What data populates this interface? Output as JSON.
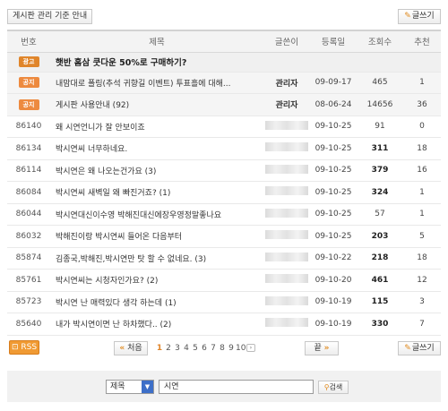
{
  "toolbar": {
    "guide_label": "게시판 관리 기준 안내",
    "write_label": "글쓰기"
  },
  "table": {
    "headers": [
      "번호",
      "제목",
      "글쓴이",
      "등록일",
      "조회수",
      "추천"
    ],
    "ad": {
      "tag": "광고",
      "title": "햇반 홈삼 쿳다운 50%로 구매하기?"
    },
    "notices": [
      {
        "tag": "공지",
        "title": "내맘대로 폴링(추석 귀향길 이벤트) 투표흘에 대해...",
        "writer": "관리자",
        "date": "09-09-17",
        "views": "465",
        "rec": "1"
      },
      {
        "tag": "공지",
        "title": "게시판 사용안내 (92)",
        "writer": "관리자",
        "date": "08-06-24",
        "views": "14656",
        "rec": "36"
      }
    ],
    "rows": [
      {
        "num": "86140",
        "title": "왜 시연언니가 잘 안보이죠",
        "date": "09-10-25",
        "views": "91",
        "hot": false,
        "rec": "0"
      },
      {
        "num": "86134",
        "title": "박시연씨 너무하네요.",
        "date": "09-10-25",
        "views": "311",
        "hot": true,
        "rec": "18"
      },
      {
        "num": "86114",
        "title": "박시연은 왜 나오는건가요 (3)",
        "date": "09-10-25",
        "views": "379",
        "hot": true,
        "rec": "16"
      },
      {
        "num": "86084",
        "title": "박시연씨 새벽일 왜 빠진거죠? (1)",
        "date": "09-10-25",
        "views": "324",
        "hot": true,
        "rec": "1"
      },
      {
        "num": "86044",
        "title": "박시연대신이수영 박해진대신에장우영정말좋나요",
        "date": "09-10-25",
        "views": "57",
        "hot": false,
        "rec": "1"
      },
      {
        "num": "86032",
        "title": "박해진이랑 박시연씨 들어온 다음부터",
        "date": "09-10-25",
        "views": "203",
        "hot": true,
        "rec": "5"
      },
      {
        "num": "85874",
        "title": "김종국,박해진,박시연만 탓 할 수 없네요. (3)",
        "date": "09-10-22",
        "views": "218",
        "hot": true,
        "rec": "18"
      },
      {
        "num": "85761",
        "title": "박시연씨는 시청자인가요? (2)",
        "date": "09-10-20",
        "views": "461",
        "hot": true,
        "rec": "12"
      },
      {
        "num": "85723",
        "title": "박시연 난 매력있다 생각 하는데 (1)",
        "date": "09-10-19",
        "views": "115",
        "hot": true,
        "rec": "3"
      },
      {
        "num": "85640",
        "title": "내가 박시연이면 난 하차했다.. (2)",
        "date": "09-10-19",
        "views": "330",
        "hot": true,
        "rec": "7"
      }
    ]
  },
  "pager": {
    "rss_label": "RSS",
    "first_label": "처음",
    "last_label": "끝",
    "pages": [
      "1",
      "2",
      "3",
      "4",
      "5",
      "6",
      "7",
      "8",
      "9",
      "10"
    ],
    "current": "1"
  },
  "search": {
    "field_selected": "제목",
    "query": "시연",
    "button_label": "검색"
  }
}
